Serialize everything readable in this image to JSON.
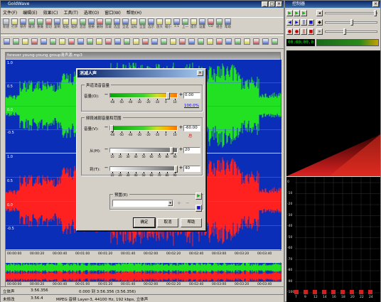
{
  "main_window": {
    "title": "GoldWave",
    "menu": [
      "文件(F)",
      "编辑(E)",
      "效果(C)",
      "工具(T)",
      "选项(O)",
      "窗口(W)",
      "帮助(H)"
    ],
    "toolbar1": [
      {
        "label": "新建",
        "icon": "new-file-icon"
      },
      {
        "label": "打开",
        "icon": "open-folder-icon"
      },
      {
        "label": "保存",
        "icon": "save-icon"
      },
      {
        "label": "撤消",
        "icon": "undo-icon"
      },
      {
        "label": "重做",
        "icon": "redo-icon"
      },
      {
        "label": "剪切",
        "icon": "cut-icon"
      },
      {
        "label": "复制",
        "icon": "copy-icon"
      },
      {
        "label": "粘贴",
        "icon": "paste-icon"
      },
      {
        "label": "粘新",
        "icon": "paste-new-icon"
      },
      {
        "label": "混音",
        "icon": "mix-icon"
      },
      {
        "label": "替换",
        "icon": "replace-icon"
      },
      {
        "label": "删除",
        "icon": "delete-icon"
      },
      {
        "label": "剪裁",
        "icon": "trim-icon"
      },
      {
        "label": "选显",
        "icon": "select-view-icon"
      },
      {
        "label": "全选",
        "icon": "select-all-icon"
      },
      {
        "label": "设标",
        "icon": "set-marker-icon"
      },
      {
        "label": "全显",
        "icon": "show-all-icon"
      },
      {
        "label": "选示",
        "icon": "show-selection-icon"
      },
      {
        "label": "放大",
        "icon": "zoom-in-icon"
      },
      {
        "label": "缩小",
        "icon": "zoom-out-icon"
      },
      {
        "label": "1:1",
        "icon": "zoom-1to1-icon"
      },
      {
        "label": "上一",
        "icon": "previous-icon"
      },
      {
        "label": "提示",
        "icon": "cue-icon"
      },
      {
        "label": "设置",
        "icon": "settings-icon"
      },
      {
        "label": "CD",
        "icon": "cd-icon"
      },
      {
        "label": "组合",
        "icon": "combine-icon"
      },
      {
        "label": "帮助",
        "icon": "help-icon"
      }
    ],
    "document": {
      "title": "forever young-young group清声源.mp3",
      "ch1_ticks": [
        "1.0",
        "0.5",
        "0.0",
        "-0.5"
      ],
      "ch2_ticks": [
        "1.0",
        "0.5",
        "0.0",
        "-0.5"
      ],
      "timeline": [
        "00:00:00",
        "00:00:20",
        "00:00:40",
        "00:01:00",
        "00:01:20",
        "00:01:40",
        "00:02:00",
        "00:02:20",
        "00:02:40",
        "00:03:00",
        "00:03:20",
        "00:03:40"
      ],
      "overview_timeline": [
        "00:00:00",
        "00:00:20",
        "00:00:40",
        "00:01:00",
        "00:01:20",
        "00:01:40",
        "00:02:00",
        "00:02:20",
        "00:02:40",
        "00:03:00",
        "00:03:20",
        "00:03:40"
      ]
    },
    "status_top": {
      "channel": "立体声",
      "length": "3:56.356",
      "selection": "0.000 到 3:56.356 (3:56.356)"
    },
    "status_bottom": {
      "state": "未修改",
      "position": "3:56.4",
      "format": "MPEG 音频 Layer-3, 44100 Hz, 192 kbps, 立体声"
    }
  },
  "dialog": {
    "title": "消减人声",
    "group1_title": "声道消音音量",
    "volume_label": "音量(O):",
    "volume_value": "0.00",
    "percent_link": "100.0%",
    "scale1": [
      "-60",
      "-50",
      "-40",
      "-30",
      "-20",
      "-10",
      "0",
      "10"
    ],
    "group2_title": "频段减弱音量和范围",
    "volume2_label": "音量(V):",
    "volume2_value": "-60.00",
    "warning_mark": "总",
    "from_label": "从(H):",
    "from_value": "20",
    "to_label": "到(T):",
    "to_value": "40",
    "scale2": [
      "-60",
      "-50",
      "-40",
      "-30",
      "-20",
      "-10",
      "0",
      "10"
    ],
    "freq_scale": [
      "10",
      "20",
      "30",
      "40",
      "50",
      "60",
      "70",
      "80",
      "90"
    ],
    "preset_label": "预置(E)",
    "preset_value": "",
    "ok": "确定",
    "cancel": "取消",
    "help": "帮助"
  },
  "control_panel": {
    "title": "控制器",
    "counter": "00:00:00.0",
    "vis_labels": [
      "0",
      "-10",
      "-20",
      "-30",
      "-40",
      "-50",
      "-60",
      "-70",
      "-80",
      "-90",
      "-100"
    ],
    "freq_labels": [
      "7",
      "9",
      "12",
      "14",
      "16",
      "18",
      "20",
      "22",
      "24"
    ]
  }
}
